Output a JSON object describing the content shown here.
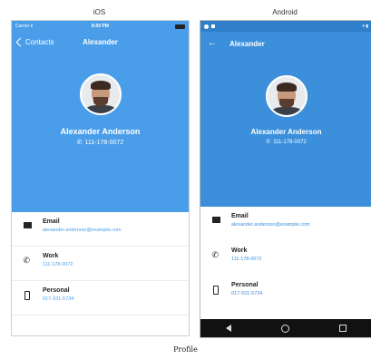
{
  "labels": {
    "ios": "iOS",
    "android": "Android",
    "caption": "Profile"
  },
  "ios": {
    "status": {
      "carrier": "Carrier",
      "time": "8:59 PM"
    },
    "nav": {
      "back_label": "Contacts",
      "title": "Alexander"
    }
  },
  "android": {
    "nav": {
      "title": "Alexander"
    }
  },
  "contact": {
    "name": "Alexander Anderson",
    "phone": "111-178-0072",
    "rows": [
      {
        "label": "Email",
        "value": "alexander.anderson@example.com",
        "icon": "email-icon"
      },
      {
        "label": "Work",
        "value": "111-178-0072",
        "icon": "phone-icon"
      },
      {
        "label": "Personal",
        "value": "017-931-5734",
        "icon": "mobile-icon"
      }
    ]
  },
  "colors": {
    "ios_blue": "#4a9ee9",
    "android_blue": "#3b8fdb",
    "android_status": "#2f7fca"
  }
}
